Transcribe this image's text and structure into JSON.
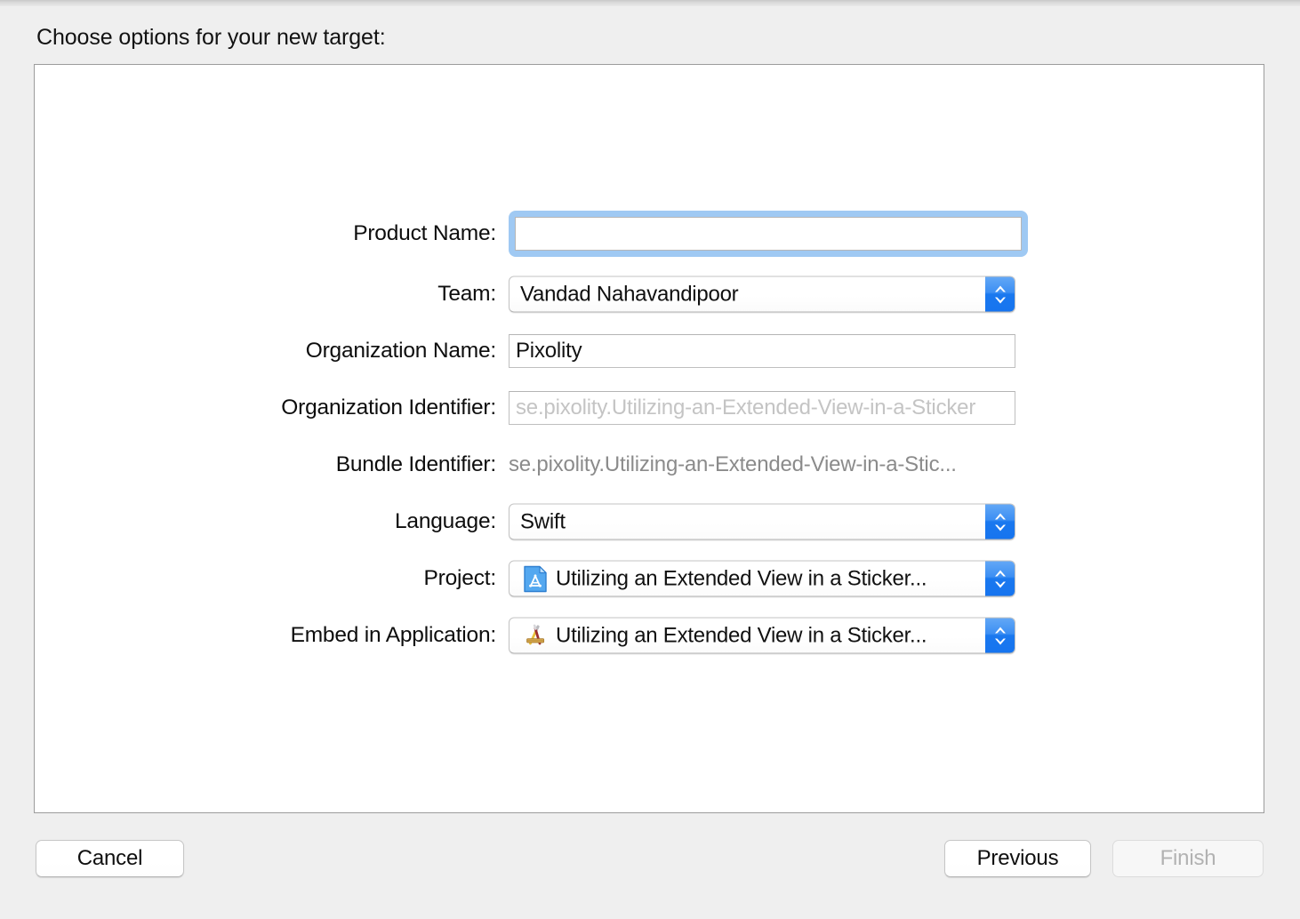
{
  "window": {
    "prompt": "Choose options for your new target:"
  },
  "form": {
    "fields": [
      {
        "label": "Product Name:",
        "type": "textfield",
        "value": "",
        "placeholder": "",
        "focused": true
      },
      {
        "label": "Team:",
        "type": "popup",
        "value": "Vandad Nahavandipoor",
        "icon": ""
      },
      {
        "label": "Organization Name:",
        "type": "textfield",
        "value": "Pixolity",
        "placeholder": "",
        "focused": false
      },
      {
        "label": "Organization Identifier:",
        "type": "textfield",
        "value": "",
        "placeholder": "se.pixolity.Utilizing-an-Extended-View-in-a-Sticker",
        "focused": false
      },
      {
        "label": "Bundle Identifier:",
        "type": "static",
        "value": "se.pixolity.Utilizing-an-Extended-View-in-a-Stic..."
      },
      {
        "label": "Language:",
        "type": "popup",
        "value": "Swift",
        "icon": ""
      },
      {
        "label": "Project:",
        "type": "popup",
        "value": "Utilizing an Extended View in a Sticker...",
        "icon": "xcode-project-document-icon"
      },
      {
        "label": "Embed in Application:",
        "type": "popup",
        "value": "Utilizing an Extended View in a Sticker...",
        "icon": "xcode-app-icon"
      }
    ]
  },
  "buttons": {
    "cancel": "Cancel",
    "previous": "Previous",
    "finish": "Finish"
  },
  "colors": {
    "background": "#efefef",
    "panel": "#ffffff",
    "panel_border": "#9c9c9c",
    "focus_ring": "#9fc9f3",
    "accent_blue": "#1a78ef",
    "placeholder_gray": "#c4c4c4",
    "static_gray": "#8b8b8b",
    "disabled_text": "#b2b2b2"
  }
}
